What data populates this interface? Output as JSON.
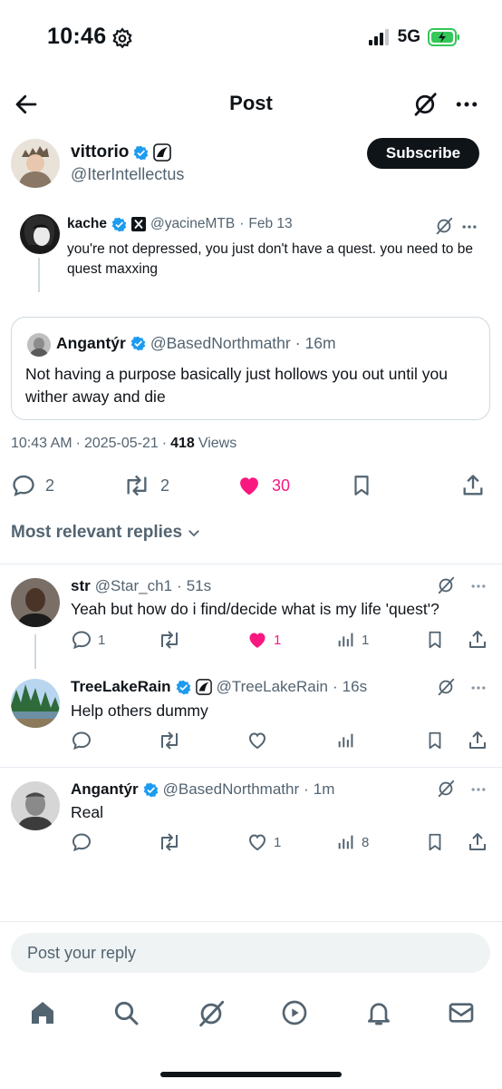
{
  "status_bar": {
    "time": "10:46",
    "network": "5G"
  },
  "header": {
    "title": "Post"
  },
  "author": {
    "name": "vittorio",
    "handle": "@IterIntellectus",
    "subscribe_label": "Subscribe"
  },
  "quoted_tweet": {
    "name": "kache",
    "handle": "@yacineMTB",
    "time": "Feb 13",
    "text": "you're not depressed, you just don't have a quest. you need to be quest maxxing"
  },
  "quoted_card": {
    "name": "Angantýr",
    "handle": "@BasedNorthmathr",
    "time": "16m",
    "text": "Not having a purpose basically just hollows you out until you wither away and die"
  },
  "meta": {
    "time": "10:43 AM",
    "date": "2025-05-21",
    "views": "418",
    "views_label": "Views"
  },
  "actions": {
    "replies": "2",
    "reposts": "2",
    "likes": "30"
  },
  "sort_label": "Most relevant replies",
  "replies": [
    {
      "name": "str",
      "handle": "@Star_ch1",
      "time": "51s",
      "text": "Yeah but how do i find/decide what is my life 'quest'?",
      "replies": "1",
      "reposts": "",
      "likes": "1",
      "views": "1",
      "liked": true
    },
    {
      "name": "TreeLakeRain",
      "handle": "@TreeLakeRain",
      "time": "16s",
      "text": "Help others dummy",
      "replies": "",
      "reposts": "",
      "likes": "",
      "views": "",
      "liked": false
    },
    {
      "name": "Angantýr",
      "handle": "@BasedNorthmathr",
      "time": "1m",
      "text": "Real",
      "replies": "",
      "reposts": "",
      "likes": "1",
      "views": "8",
      "liked": false
    }
  ],
  "reply_box": {
    "placeholder": "Post your reply"
  },
  "colors": {
    "accent": "#1d9bf0",
    "like": "#f91880",
    "text": "#0f1419",
    "secondary": "#536471",
    "battery": "#34c759"
  },
  "icons": [
    "back-arrow-icon",
    "grok-icon",
    "more-icon",
    "verified-icon",
    "x-logo-icon",
    "reply-icon",
    "repost-icon",
    "heart-icon",
    "bookmark-icon",
    "share-icon",
    "views-icon",
    "chevron-down-icon",
    "home-icon",
    "search-icon",
    "video-icon",
    "bell-icon",
    "mail-icon"
  ]
}
